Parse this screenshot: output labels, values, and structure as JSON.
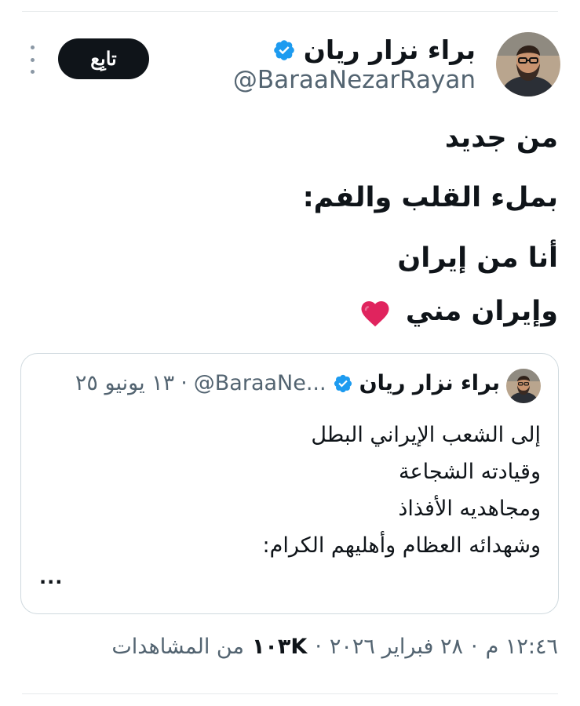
{
  "tweet": {
    "author": {
      "name": "براء نزار ريان",
      "handle": "@BaraaNezarRayan",
      "verified": true
    },
    "follow_label": "تابِع",
    "lines": [
      "من جديد",
      "بملء القلب والفم:",
      "أنا من إيران",
      "وإيران مني"
    ],
    "emoji": "red-heart-icon",
    "quoted": {
      "name": "براء نزار ريان",
      "handle": "@BaraaNe...",
      "separator": "·",
      "date": "١٣ يونيو ٢٥",
      "lines": [
        "إلى الشعب الإيراني البطل",
        "وقيادته الشجاعة",
        "ومجاهديه الأفذاذ",
        "وشهدائه العظام وأهليهم الكرام:"
      ],
      "ellipsis": "..."
    },
    "meta": {
      "time": "١٢:٤٦ م",
      "separator": "·",
      "date": "٢٨ فبراير ٢٠٢٦",
      "separator2": "·",
      "views": "١٠٣K",
      "views_label": "من المشاهدات"
    }
  },
  "colors": {
    "text": "#0f1419",
    "secondary": "#536471",
    "verified": "#1d9bf0",
    "border": "#cfd9de",
    "follow_bg": "#0f1419",
    "heart": "#e0245e"
  }
}
